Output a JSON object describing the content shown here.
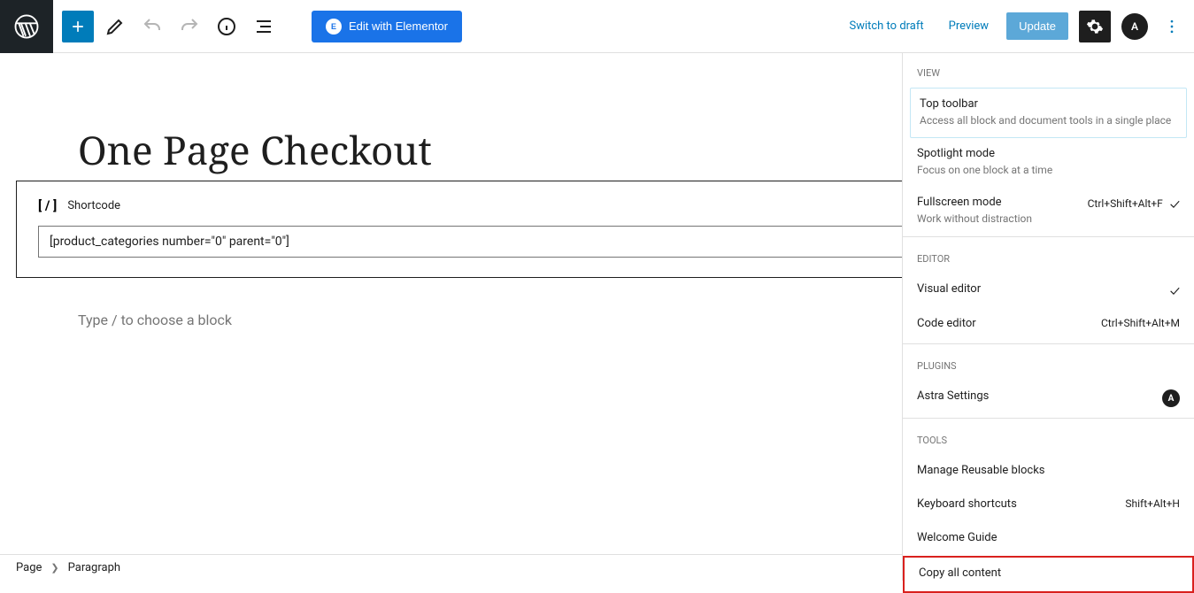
{
  "toolbar": {
    "elementor_label": "Edit with Elementor",
    "switch_draft": "Switch to draft",
    "preview": "Preview",
    "update": "Update"
  },
  "page": {
    "title": "One Page Checkout"
  },
  "shortcode": {
    "label": "Shortcode",
    "value": "[product_categories number=\"0\" parent=\"0\"]"
  },
  "placeholder": {
    "text": "Type / to choose a block"
  },
  "breadcrumb": {
    "root": "Page",
    "current": "Paragraph"
  },
  "dropdown": {
    "sections": {
      "view": "View",
      "editor": "Editor",
      "plugins": "Plugins",
      "tools": "Tools"
    },
    "top_toolbar": {
      "title": "Top toolbar",
      "desc": "Access all block and document tools in a single place"
    },
    "spotlight": {
      "title": "Spotlight mode",
      "desc": "Focus on one block at a time"
    },
    "fullscreen": {
      "title": "Fullscreen mode",
      "desc": "Work without distraction",
      "shortcut": "Ctrl+Shift+Alt+F"
    },
    "visual": {
      "title": "Visual editor"
    },
    "code": {
      "title": "Code editor",
      "shortcut": "Ctrl+Shift+Alt+M"
    },
    "astra": {
      "title": "Astra Settings"
    },
    "reusable": {
      "title": "Manage Reusable blocks"
    },
    "shortcuts": {
      "title": "Keyboard shortcuts",
      "shortcut": "Shift+Alt+H"
    },
    "welcome": {
      "title": "Welcome Guide"
    },
    "copy": {
      "title": "Copy all content"
    }
  }
}
